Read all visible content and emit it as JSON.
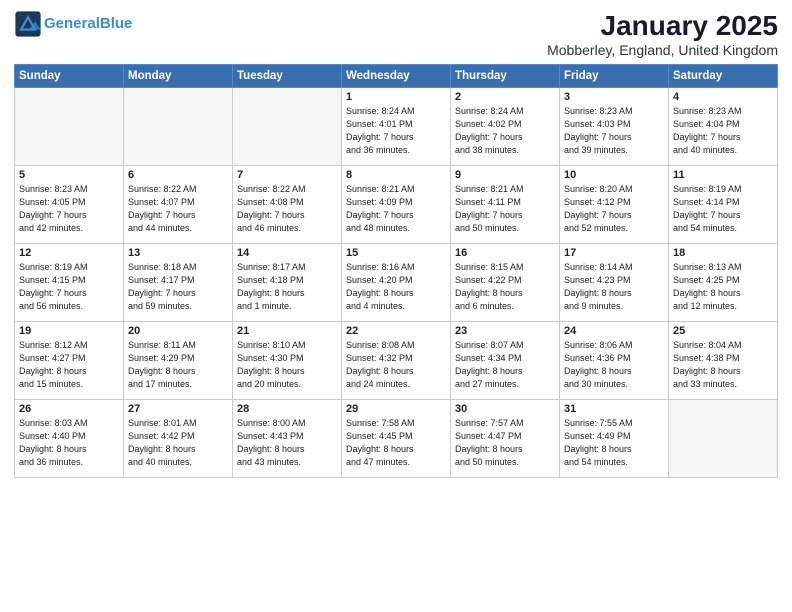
{
  "header": {
    "logo_line1": "General",
    "logo_line2": "Blue",
    "main_title": "January 2025",
    "subtitle": "Mobberley, England, United Kingdom"
  },
  "weekdays": [
    "Sunday",
    "Monday",
    "Tuesday",
    "Wednesday",
    "Thursday",
    "Friday",
    "Saturday"
  ],
  "weeks": [
    [
      {
        "day": "",
        "info": ""
      },
      {
        "day": "",
        "info": ""
      },
      {
        "day": "",
        "info": ""
      },
      {
        "day": "1",
        "info": "Sunrise: 8:24 AM\nSunset: 4:01 PM\nDaylight: 7 hours\nand 36 minutes."
      },
      {
        "day": "2",
        "info": "Sunrise: 8:24 AM\nSunset: 4:02 PM\nDaylight: 7 hours\nand 38 minutes."
      },
      {
        "day": "3",
        "info": "Sunrise: 8:23 AM\nSunset: 4:03 PM\nDaylight: 7 hours\nand 39 minutes."
      },
      {
        "day": "4",
        "info": "Sunrise: 8:23 AM\nSunset: 4:04 PM\nDaylight: 7 hours\nand 40 minutes."
      }
    ],
    [
      {
        "day": "5",
        "info": "Sunrise: 8:23 AM\nSunset: 4:05 PM\nDaylight: 7 hours\nand 42 minutes."
      },
      {
        "day": "6",
        "info": "Sunrise: 8:22 AM\nSunset: 4:07 PM\nDaylight: 7 hours\nand 44 minutes."
      },
      {
        "day": "7",
        "info": "Sunrise: 8:22 AM\nSunset: 4:08 PM\nDaylight: 7 hours\nand 46 minutes."
      },
      {
        "day": "8",
        "info": "Sunrise: 8:21 AM\nSunset: 4:09 PM\nDaylight: 7 hours\nand 48 minutes."
      },
      {
        "day": "9",
        "info": "Sunrise: 8:21 AM\nSunset: 4:11 PM\nDaylight: 7 hours\nand 50 minutes."
      },
      {
        "day": "10",
        "info": "Sunrise: 8:20 AM\nSunset: 4:12 PM\nDaylight: 7 hours\nand 52 minutes."
      },
      {
        "day": "11",
        "info": "Sunrise: 8:19 AM\nSunset: 4:14 PM\nDaylight: 7 hours\nand 54 minutes."
      }
    ],
    [
      {
        "day": "12",
        "info": "Sunrise: 8:19 AM\nSunset: 4:15 PM\nDaylight: 7 hours\nand 56 minutes."
      },
      {
        "day": "13",
        "info": "Sunrise: 8:18 AM\nSunset: 4:17 PM\nDaylight: 7 hours\nand 59 minutes."
      },
      {
        "day": "14",
        "info": "Sunrise: 8:17 AM\nSunset: 4:18 PM\nDaylight: 8 hours\nand 1 minute."
      },
      {
        "day": "15",
        "info": "Sunrise: 8:16 AM\nSunset: 4:20 PM\nDaylight: 8 hours\nand 4 minutes."
      },
      {
        "day": "16",
        "info": "Sunrise: 8:15 AM\nSunset: 4:22 PM\nDaylight: 8 hours\nand 6 minutes."
      },
      {
        "day": "17",
        "info": "Sunrise: 8:14 AM\nSunset: 4:23 PM\nDaylight: 8 hours\nand 9 minutes."
      },
      {
        "day": "18",
        "info": "Sunrise: 8:13 AM\nSunset: 4:25 PM\nDaylight: 8 hours\nand 12 minutes."
      }
    ],
    [
      {
        "day": "19",
        "info": "Sunrise: 8:12 AM\nSunset: 4:27 PM\nDaylight: 8 hours\nand 15 minutes."
      },
      {
        "day": "20",
        "info": "Sunrise: 8:11 AM\nSunset: 4:29 PM\nDaylight: 8 hours\nand 17 minutes."
      },
      {
        "day": "21",
        "info": "Sunrise: 8:10 AM\nSunset: 4:30 PM\nDaylight: 8 hours\nand 20 minutes."
      },
      {
        "day": "22",
        "info": "Sunrise: 8:08 AM\nSunset: 4:32 PM\nDaylight: 8 hours\nand 24 minutes."
      },
      {
        "day": "23",
        "info": "Sunrise: 8:07 AM\nSunset: 4:34 PM\nDaylight: 8 hours\nand 27 minutes."
      },
      {
        "day": "24",
        "info": "Sunrise: 8:06 AM\nSunset: 4:36 PM\nDaylight: 8 hours\nand 30 minutes."
      },
      {
        "day": "25",
        "info": "Sunrise: 8:04 AM\nSunset: 4:38 PM\nDaylight: 8 hours\nand 33 minutes."
      }
    ],
    [
      {
        "day": "26",
        "info": "Sunrise: 8:03 AM\nSunset: 4:40 PM\nDaylight: 8 hours\nand 36 minutes."
      },
      {
        "day": "27",
        "info": "Sunrise: 8:01 AM\nSunset: 4:42 PM\nDaylight: 8 hours\nand 40 minutes."
      },
      {
        "day": "28",
        "info": "Sunrise: 8:00 AM\nSunset: 4:43 PM\nDaylight: 8 hours\nand 43 minutes."
      },
      {
        "day": "29",
        "info": "Sunrise: 7:58 AM\nSunset: 4:45 PM\nDaylight: 8 hours\nand 47 minutes."
      },
      {
        "day": "30",
        "info": "Sunrise: 7:57 AM\nSunset: 4:47 PM\nDaylight: 8 hours\nand 50 minutes."
      },
      {
        "day": "31",
        "info": "Sunrise: 7:55 AM\nSunset: 4:49 PM\nDaylight: 8 hours\nand 54 minutes."
      },
      {
        "day": "",
        "info": ""
      }
    ]
  ]
}
